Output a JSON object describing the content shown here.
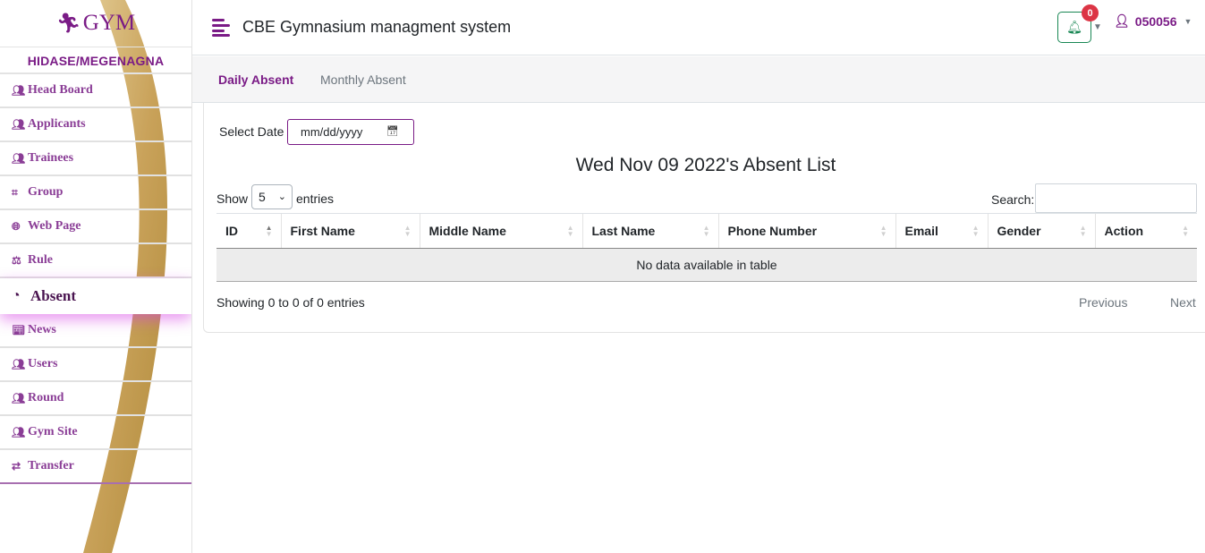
{
  "brand": {
    "text": "GYM",
    "icon": "running-person-icon"
  },
  "branch": "HIDASE/MEGENAGNA",
  "sidebar": {
    "items": [
      {
        "label": "Head Board",
        "icon": "users-icon"
      },
      {
        "label": "Applicants",
        "icon": "users-icon"
      },
      {
        "label": "Trainees",
        "icon": "users-icon"
      },
      {
        "label": "Group",
        "icon": "object-group-icon"
      },
      {
        "label": "Web Page",
        "icon": "globe-icon"
      },
      {
        "label": "Rule",
        "icon": "scale-icon"
      },
      {
        "label": "Absent",
        "icon": "clock-icon",
        "active": true
      },
      {
        "label": "News",
        "icon": "newspaper-icon"
      },
      {
        "label": "Users",
        "icon": "users-icon"
      },
      {
        "label": "Round",
        "icon": "users-icon"
      },
      {
        "label": "Gym Site",
        "icon": "users-icon"
      },
      {
        "label": "Transfer",
        "icon": "exchange-icon"
      }
    ]
  },
  "header": {
    "title": "CBE Gymnasium managment system",
    "notifications": {
      "count": "0",
      "icon": "bell-icon"
    },
    "user": {
      "name": "050056",
      "icon": "user-check-icon"
    }
  },
  "tabs": [
    {
      "label": "Daily Absent",
      "active": true
    },
    {
      "label": "Monthly Absent",
      "active": false
    }
  ],
  "filter": {
    "label": "Select Date",
    "placeholder": "mm/dd/yyyy"
  },
  "list": {
    "title": "Wed Nov 09 2022's Absent List",
    "show_label": "Show",
    "entries_value": "5",
    "entries_label": "entries",
    "search_label": "Search:",
    "columns": [
      "ID",
      "First Name",
      "Middle Name",
      "Last Name",
      "Phone Number",
      "Email",
      "Gender",
      "Action"
    ],
    "empty_message": "No data available in table",
    "info": "Showing 0 to 0 of 0 entries",
    "prev_label": "Previous",
    "next_label": "Next"
  },
  "colors": {
    "brand": "#7a1b86",
    "accent_gold": "#c9a25a",
    "success": "#198754",
    "danger": "#dc3545"
  }
}
